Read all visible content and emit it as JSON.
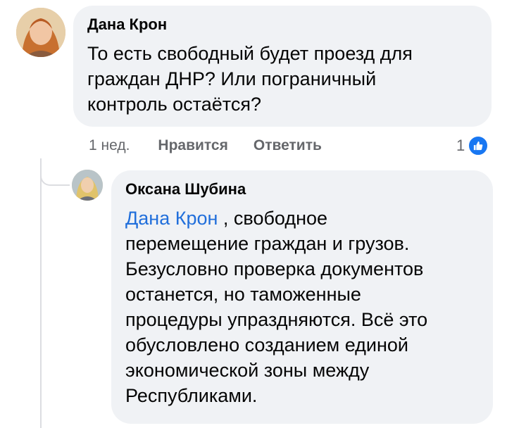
{
  "comment": {
    "author": "Дана Крон",
    "lines": [
      "То есть свободный будет проезд для",
      "граждан ДНР? Или пограничный",
      "контроль остаётся?"
    ],
    "time": "1 нед.",
    "like_label": "Нравится",
    "reply_label": "Ответить",
    "reaction_count": "1",
    "reaction_icon": "like-icon",
    "reaction_color": "#1877f2"
  },
  "reply": {
    "author": "Оксана Шубина",
    "mention": "Дана Крон",
    "first_line_rest": " , свободное",
    "lines": [
      "перемещение граждан и грузов.",
      "Безусловно проверка документов",
      "останется, но таможенные",
      "процедуры упраздняются. Всё это",
      "обусловлено созданием единой",
      "экономической зоны между",
      "Республиками."
    ]
  },
  "colors": {
    "bubble": "#f0f2f5",
    "mention": "#216fdb",
    "meta": "#65676b"
  }
}
